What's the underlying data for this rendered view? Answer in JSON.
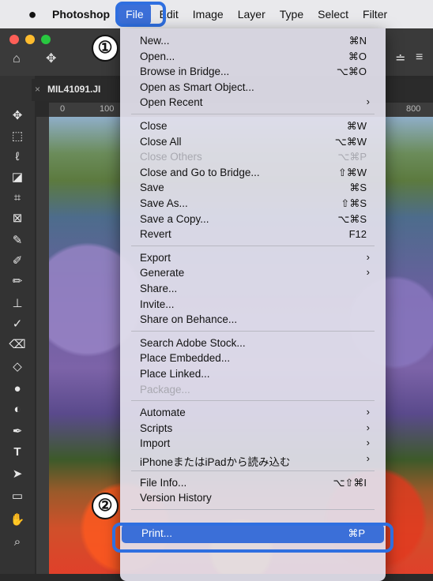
{
  "menubar": {
    "apple": "",
    "items": [
      "Photoshop",
      "File",
      "Edit",
      "Image",
      "Layer",
      "Type",
      "Select",
      "Filter"
    ]
  },
  "document": {
    "tab_name": "MIL41091.JI",
    "close_glyph": "×",
    "ruler_top": [
      "0",
      "100",
      "800"
    ]
  },
  "callouts": {
    "one": "①",
    "two": "②"
  },
  "file_menu": {
    "groups": [
      [
        {
          "label": "New...",
          "shortcut": "⌘N"
        },
        {
          "label": "Open...",
          "shortcut": "⌘O"
        },
        {
          "label": "Browse in Bridge...",
          "shortcut": "⌥⌘O"
        },
        {
          "label": "Open as Smart Object...",
          "shortcut": ""
        },
        {
          "label": "Open Recent",
          "shortcut": "",
          "submenu": true
        }
      ],
      [
        {
          "label": "Close",
          "shortcut": "⌘W"
        },
        {
          "label": "Close All",
          "shortcut": "⌥⌘W"
        },
        {
          "label": "Close Others",
          "shortcut": "⌥⌘P",
          "disabled": true
        },
        {
          "label": "Close and Go to Bridge...",
          "shortcut": "⇧⌘W"
        },
        {
          "label": "Save",
          "shortcut": "⌘S"
        },
        {
          "label": "Save As...",
          "shortcut": "⇧⌘S"
        },
        {
          "label": "Save a Copy...",
          "shortcut": "⌥⌘S"
        },
        {
          "label": "Revert",
          "shortcut": "F12"
        }
      ],
      [
        {
          "label": "Export",
          "shortcut": "",
          "submenu": true
        },
        {
          "label": "Generate",
          "shortcut": "",
          "submenu": true
        },
        {
          "label": "Share...",
          "shortcut": ""
        },
        {
          "label": "Invite...",
          "shortcut": ""
        },
        {
          "label": "Share on Behance...",
          "shortcut": ""
        }
      ],
      [
        {
          "label": "Search Adobe Stock...",
          "shortcut": ""
        },
        {
          "label": "Place Embedded...",
          "shortcut": ""
        },
        {
          "label": "Place Linked...",
          "shortcut": ""
        },
        {
          "label": "Package...",
          "shortcut": "",
          "disabled": true
        }
      ],
      [
        {
          "label": "Automate",
          "shortcut": "",
          "submenu": true
        },
        {
          "label": "Scripts",
          "shortcut": "",
          "submenu": true
        },
        {
          "label": "Import",
          "shortcut": "",
          "submenu": true
        },
        {
          "label": "iPhoneまたはiPadから読み込む",
          "shortcut": "",
          "submenu": true
        }
      ],
      [
        {
          "label": "File Info...",
          "shortcut": "⌥⇧⌘I"
        },
        {
          "label": "Version History",
          "shortcut": ""
        }
      ],
      [
        {
          "label": "Print...",
          "shortcut": "⌘P",
          "highlighted": true
        }
      ]
    ],
    "submenu_glyph": "›"
  },
  "colors": {
    "accent": "#3b6fd8",
    "callout_ring": "#2f6fe0"
  }
}
